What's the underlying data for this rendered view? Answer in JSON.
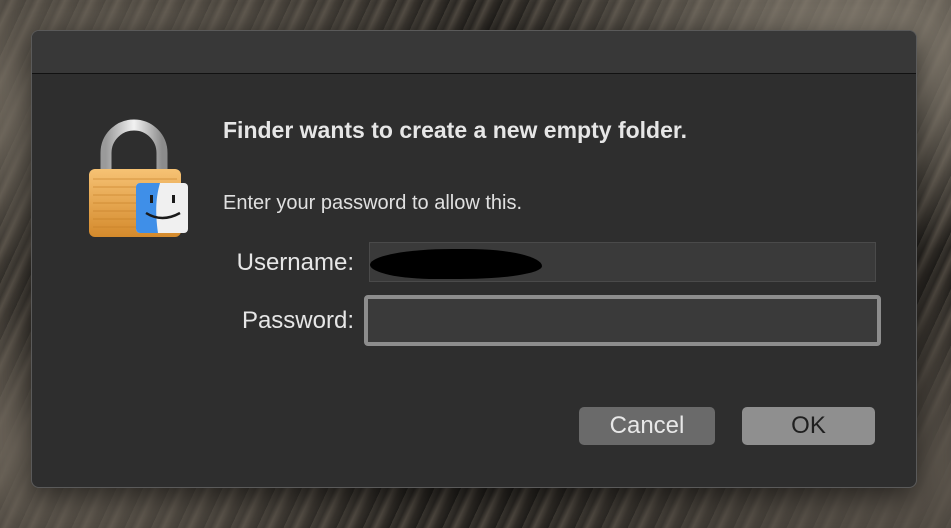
{
  "dialog": {
    "title": "Finder wants to create a new empty folder.",
    "subtitle": "Enter your password to allow this.",
    "icon": "lock-with-finder-icon"
  },
  "fields": {
    "username_label": "Username:",
    "username_value": "",
    "username_redacted": true,
    "password_label": "Password:",
    "password_value": ""
  },
  "buttons": {
    "cancel_label": "Cancel",
    "ok_label": "OK"
  },
  "colors": {
    "dialog_bg": "#2e2e2e",
    "titlebar_bg": "#383838",
    "focus_ring": "#8d8d8d",
    "lock_gold": "#e9a04a",
    "finder_blue": "#3f8fe8"
  }
}
